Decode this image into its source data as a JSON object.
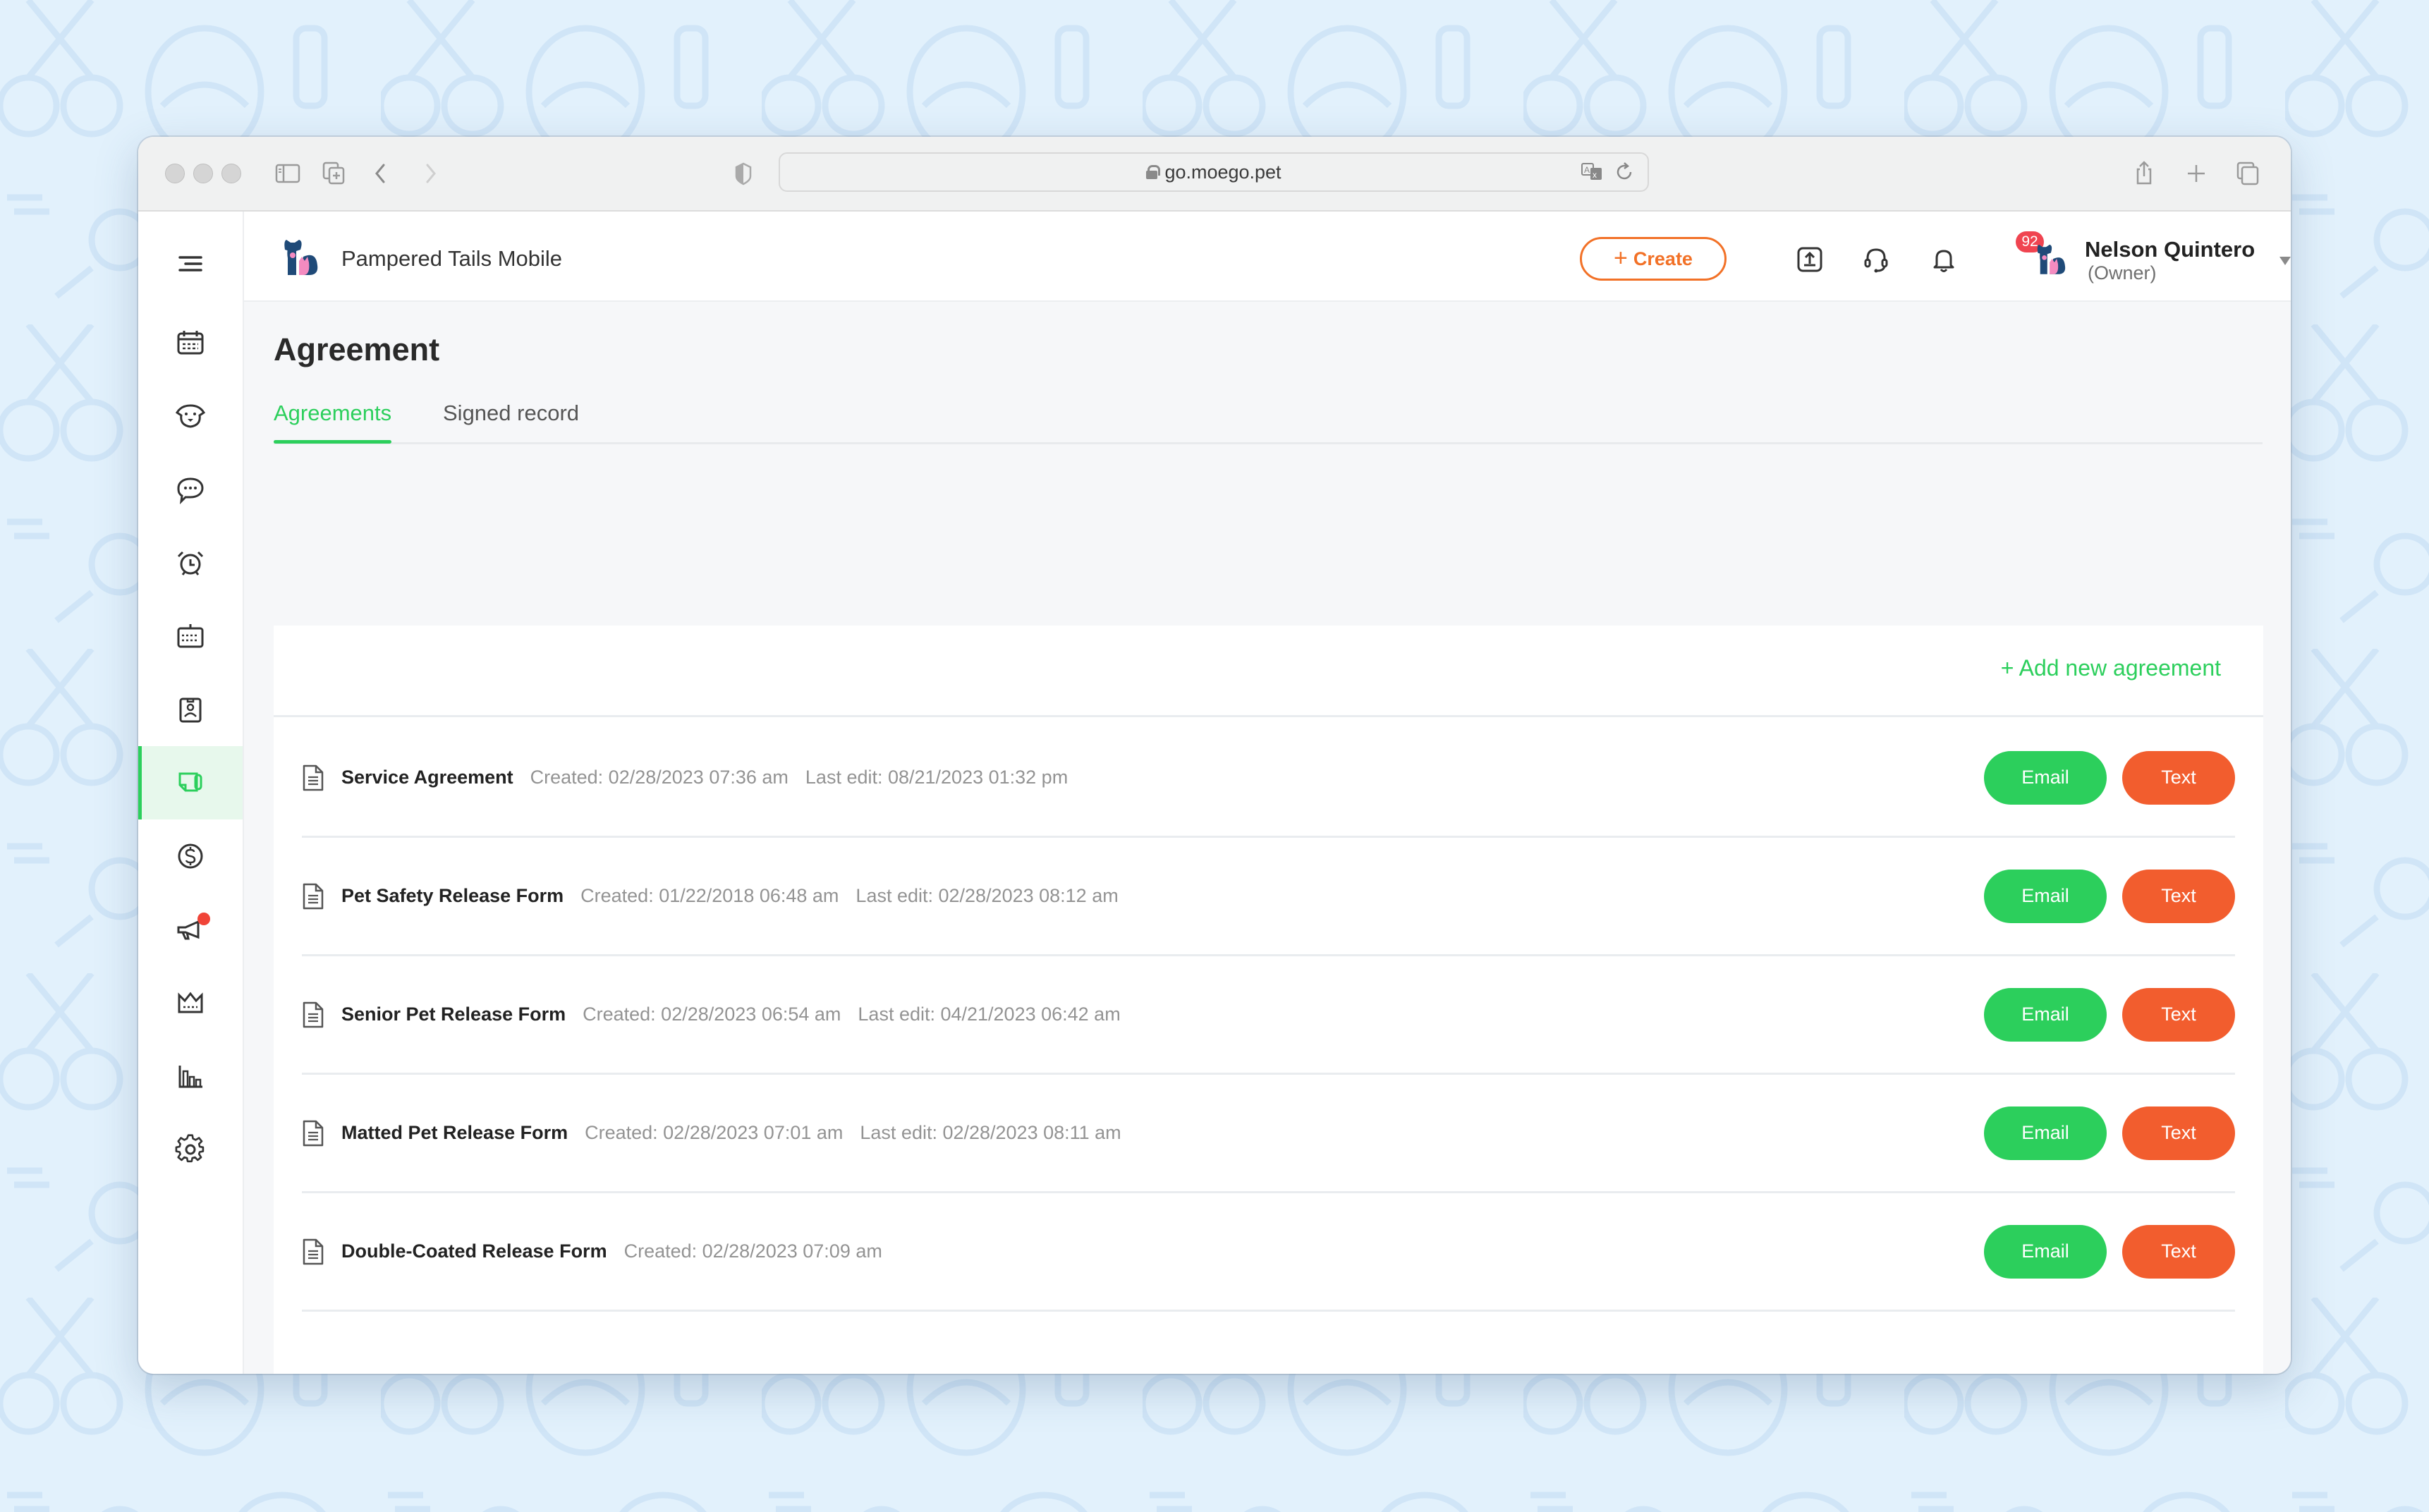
{
  "browser": {
    "url": "go.moego.pet",
    "toolbar_icons": [
      "sidebar-toggle-icon",
      "new-tab-group-icon",
      "back-icon",
      "forward-icon",
      "privacy-shield-icon"
    ],
    "url_icons": [
      "translate-icon",
      "reload-icon"
    ],
    "right_icons": [
      "share-icon",
      "new-tab-icon",
      "tab-overview-icon"
    ]
  },
  "sidebar": {
    "items": [
      {
        "name": "menu",
        "icon": "menu-icon"
      },
      {
        "name": "calendar",
        "icon": "calendar-icon"
      },
      {
        "name": "clients-pets",
        "icon": "dog-face-icon"
      },
      {
        "name": "messages",
        "icon": "chat-bubble-icon"
      },
      {
        "name": "reminders",
        "icon": "alarm-clock-icon"
      },
      {
        "name": "schedule",
        "icon": "calendar-grid-icon"
      },
      {
        "name": "staff",
        "icon": "id-badge-icon"
      },
      {
        "name": "agreements",
        "icon": "agreement-icon",
        "active": true
      },
      {
        "name": "payments",
        "icon": "dollar-circle-icon"
      },
      {
        "name": "marketing",
        "icon": "megaphone-icon",
        "dot": true
      },
      {
        "name": "membership",
        "icon": "crown-icon"
      },
      {
        "name": "reports",
        "icon": "bar-chart-icon"
      },
      {
        "name": "settings",
        "icon": "gear-icon"
      }
    ]
  },
  "header": {
    "business_name": "Pampered Tails Mobile",
    "create_label": "Create",
    "create_plus": "+",
    "notification_count": "92",
    "user_name": "Nelson Quintero",
    "user_role": "(Owner)"
  },
  "page": {
    "title": "Agreement",
    "tabs": [
      {
        "label": "Agreements",
        "active": true
      },
      {
        "label": "Signed record",
        "active": false
      }
    ],
    "add_label": "+ Add new agreement"
  },
  "agreements": [
    {
      "name": "Service Agreement",
      "created": "Created: 02/28/2023 07:36 am",
      "last_edit": "Last edit: 08/21/2023 01:32 pm",
      "email_label": "Email",
      "text_label": "Text"
    },
    {
      "name": "Pet Safety Release Form",
      "created": "Created: 01/22/2018 06:48 am",
      "last_edit": "Last edit: 02/28/2023 08:12 am",
      "email_label": "Email",
      "text_label": "Text"
    },
    {
      "name": "Senior Pet Release Form",
      "created": "Created: 02/28/2023 06:54 am",
      "last_edit": "Last edit: 04/21/2023 06:42 am",
      "email_label": "Email",
      "text_label": "Text"
    },
    {
      "name": "Matted Pet Release Form",
      "created": "Created: 02/28/2023 07:01 am",
      "last_edit": "Last edit: 02/28/2023 08:11 am",
      "email_label": "Email",
      "text_label": "Text"
    },
    {
      "name": "Double-Coated Release Form",
      "created": "Created: 02/28/2023 07:09 am",
      "last_edit": null,
      "email_label": "Email",
      "text_label": "Text"
    }
  ],
  "colors": {
    "accent_green": "#2ccf5c",
    "accent_orange": "#f27127",
    "text_button": "#f25d2e",
    "badge_red": "#f04450",
    "chat_fab": "#f96e1e"
  }
}
